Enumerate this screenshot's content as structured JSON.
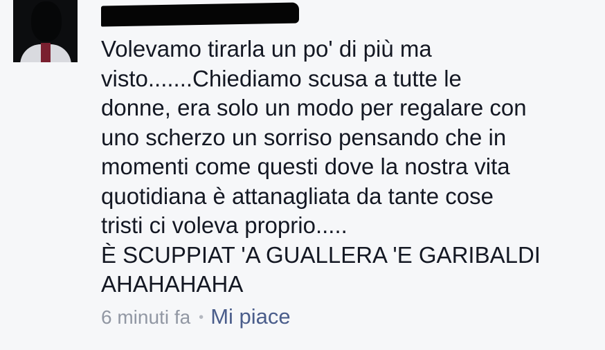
{
  "comment": {
    "lines": [
      "Volevamo tirarla un po' di più ma",
      "visto.......Chiediamo scusa a tutte le",
      "donne, era solo un modo per regalare con",
      "uno scherzo un sorriso pensando che in",
      "momenti come questi dove la nostra vita",
      "quotidiana è attanagliata da tante cose",
      "tristi ci voleva proprio.....",
      "È SCUPPIAT 'A GUALLERA 'E GARIBALDI",
      "AHAHAHAHA"
    ],
    "timestamp": "6 minuti fa",
    "separator": "•",
    "like_label": "Mi piace"
  },
  "colors": {
    "background": "#f6f7f9",
    "text": "#141823",
    "timestamp": "#9197a3",
    "like_link": "#4a5d8b"
  }
}
